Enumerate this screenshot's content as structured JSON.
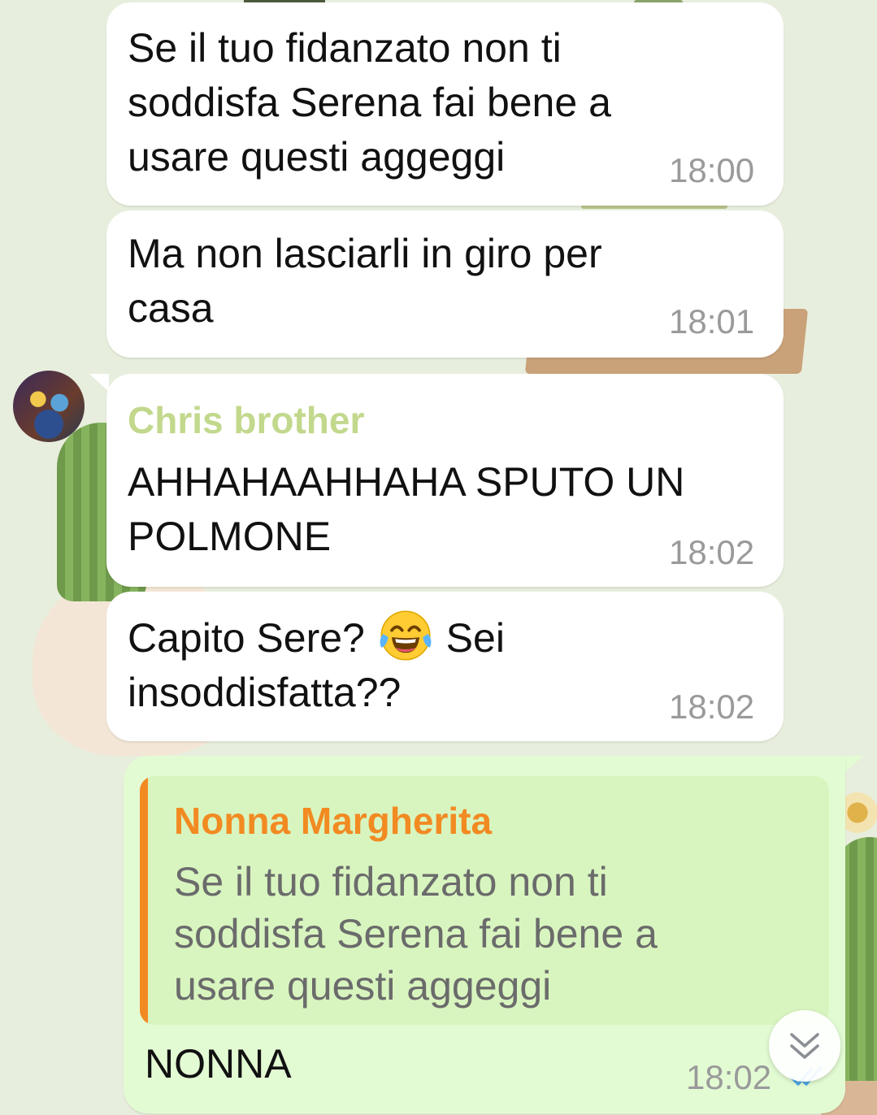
{
  "messages": [
    {
      "lines": [
        "Se il tuo fidanzato non ti",
        "soddisfa Serena fai bene a",
        "usare questi aggeggi"
      ],
      "time": "18:00"
    },
    {
      "lines": [
        "Ma non lasciarli in giro per",
        "casa"
      ],
      "time": "18:01"
    },
    {
      "sender": "Chris brother",
      "lines": [
        "AHHAHAAHHAHA SPUTO UN",
        "POLMONE"
      ],
      "time": "18:02"
    },
    {
      "line1_before": "Capito Sere?",
      "emoji": "face-with-tears-of-joy",
      "line1_after": "Sei",
      "line2": "insoddisfatta??",
      "time": "18:02"
    }
  ],
  "reply": {
    "quoted_name": "Nonna Margherita",
    "quoted_lines": [
      "Se il tuo fidanzato non ti",
      "soddisfa Serena fai bene a",
      "usare questi aggeggi"
    ],
    "text": "NONNA",
    "time": "18:02",
    "status": "double-check-icon"
  },
  "colors": {
    "incoming_bubble": "#ffffff",
    "outgoing_bubble": "#e3fbd3",
    "quote_bar": "#f28a22",
    "sender_name": "#c2d88c",
    "read_ticks": "#4fa8e8"
  },
  "icons": {
    "scroll_down": "chevron-double-down-icon"
  }
}
